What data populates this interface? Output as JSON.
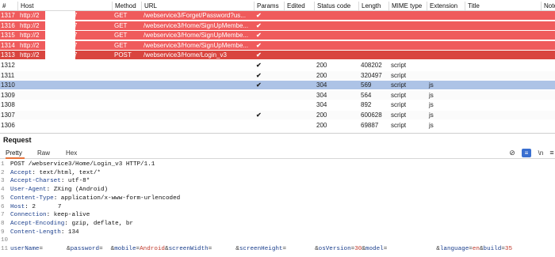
{
  "history": {
    "columns": {
      "id": "#",
      "host": "Host",
      "method": "Method",
      "url": "URL",
      "params": "Params",
      "edited": "Edited",
      "status": "Status code",
      "length": "Length",
      "mime": "MIME type",
      "extension": "Extension",
      "title": "Title",
      "notes": "Notes"
    },
    "rows": [
      {
        "id": "1317",
        "host": "http://2",
        "host_suffix": "7",
        "method": "GET",
        "url": "/webservice3/Forget/Password?us...",
        "params": "✔",
        "status": "",
        "length": "",
        "mime": "",
        "ext": "",
        "style": "red"
      },
      {
        "id": "1316",
        "host": "http://2",
        "host_suffix": "7",
        "method": "GET",
        "url": "/webservice3/Home/SignUpMembe...",
        "params": "✔",
        "status": "",
        "length": "",
        "mime": "",
        "ext": "",
        "style": "red"
      },
      {
        "id": "1315",
        "host": "http://2",
        "host_suffix": "7",
        "method": "GET",
        "url": "/webservice3/Home/SignUpMembe...",
        "params": "✔",
        "status": "",
        "length": "",
        "mime": "",
        "ext": "",
        "style": "red"
      },
      {
        "id": "1314",
        "host": "http://2",
        "host_suffix": "7",
        "method": "GET",
        "url": "/webservice3/Home/SignUpMembe...",
        "params": "✔",
        "status": "",
        "length": "",
        "mime": "",
        "ext": "",
        "style": "red"
      },
      {
        "id": "1313",
        "host": "http://2",
        "host_suffix": "7",
        "method": "POST",
        "url": "/webservice3/Home/Login_v3",
        "params": "✔",
        "status": "",
        "length": "",
        "mime": "",
        "ext": "",
        "style": "red-dark"
      },
      {
        "id": "1312",
        "host": "",
        "host_suffix": "",
        "method": "",
        "url": "",
        "params": "✔",
        "status": "200",
        "length": "408202",
        "mime": "script",
        "ext": "",
        "style": "white"
      },
      {
        "id": "1311",
        "host": "",
        "host_suffix": "",
        "method": "",
        "url": "",
        "params": "✔",
        "status": "200",
        "length": "320497",
        "mime": "script",
        "ext": "",
        "style": "white"
      },
      {
        "id": "1310",
        "host": "",
        "host_suffix": "",
        "method": "",
        "url": "",
        "params": "✔",
        "status": "304",
        "length": "569",
        "mime": "script",
        "ext": "js",
        "style": "blue"
      },
      {
        "id": "1309",
        "host": "",
        "host_suffix": "",
        "method": "",
        "url": "",
        "params": "",
        "status": "304",
        "length": "564",
        "mime": "script",
        "ext": "js",
        "style": "white"
      },
      {
        "id": "1308",
        "host": "",
        "host_suffix": "",
        "method": "",
        "url": "",
        "params": "",
        "status": "304",
        "length": "892",
        "mime": "script",
        "ext": "js",
        "style": "white"
      },
      {
        "id": "1307",
        "host": "",
        "host_suffix": "",
        "method": "",
        "url": "",
        "params": "✔",
        "status": "200",
        "length": "600628",
        "mime": "script",
        "ext": "js",
        "style": "white"
      },
      {
        "id": "1306",
        "host": "",
        "host_suffix": "",
        "method": "",
        "url": "",
        "params": "",
        "status": "200",
        "length": "69887",
        "mime": "script",
        "ext": "js",
        "style": "white"
      }
    ]
  },
  "request": {
    "title": "Request",
    "tabs": [
      "Pretty",
      "Raw",
      "Hex"
    ],
    "active_tab": "Pretty",
    "toolbar": {
      "eye": "⊘",
      "wrap": "≡",
      "newline": "\\n",
      "menu": "≡"
    },
    "lines": [
      {
        "n": "1",
        "text": "POST /webservice3/Home/Login_v3 HTTP/1.1"
      },
      {
        "n": "2",
        "key": "Accept",
        "val": " text/html, text/*"
      },
      {
        "n": "3",
        "key": "Accept-Charset",
        "val": " utf-8*"
      },
      {
        "n": "4",
        "key": "User-Agent",
        "val": " ZXing (Android)"
      },
      {
        "n": "5",
        "key": "Content-Type",
        "val": " application/x-www-form-urlencoded"
      },
      {
        "n": "6",
        "key": "Host",
        "val": " 2",
        "val_suffix": "7"
      },
      {
        "n": "7",
        "key": "Connection",
        "val": " keep-alive"
      },
      {
        "n": "8",
        "key": "Accept-Encoding",
        "val": " gzip, deflate, br"
      },
      {
        "n": "9",
        "key": "Content-Length",
        "val": " 134"
      },
      {
        "n": "10",
        "text": ""
      },
      {
        "n": "11",
        "body": [
          {
            "k": "userName",
            "v": ""
          },
          {
            "k": "password",
            "v": ""
          },
          {
            "k": "mobile",
            "v": "Android"
          },
          {
            "k": "screenWidth",
            "v": ""
          },
          {
            "k": "screenHeight",
            "v": ""
          },
          {
            "k": "osVersion",
            "v": "30"
          },
          {
            "k": "model",
            "v": ""
          },
          {
            "k": "language",
            "v": "en"
          },
          {
            "k": "build",
            "v": "35"
          }
        ]
      }
    ]
  },
  "colors": {
    "red_row": "#ef5b5c",
    "red_row_dark": "#d9453f",
    "selected_row": "#adc3e6",
    "active_tab_underline": "#e8743b",
    "wrap_button": "#3a6fd0"
  }
}
